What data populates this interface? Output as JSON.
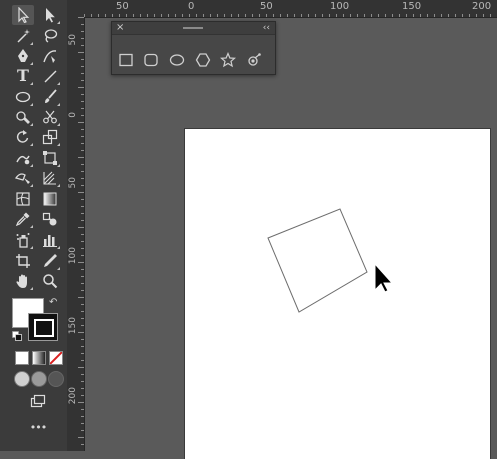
{
  "app": {
    "name": "Adobe Illustrator"
  },
  "toolbar": {
    "tools": [
      {
        "name": "selection-tool",
        "icon": "arrow-icon"
      },
      {
        "name": "direct-selection-tool",
        "icon": "white-arrow-icon"
      },
      {
        "name": "magic-wand-tool",
        "icon": "magic-wand-icon"
      },
      {
        "name": "lasso-tool",
        "icon": "lasso-icon"
      },
      {
        "name": "pen-tool",
        "icon": "pen-icon"
      },
      {
        "name": "curvature-tool",
        "icon": "curvature-pen-icon"
      },
      {
        "name": "type-tool",
        "icon": "type-icon",
        "glyph": "T"
      },
      {
        "name": "line-segment-tool",
        "icon": "line-icon"
      },
      {
        "name": "ellipse-tool",
        "icon": "ellipse-icon"
      },
      {
        "name": "paintbrush-tool",
        "icon": "brush-icon"
      },
      {
        "name": "shaper-tool",
        "icon": "shaper-icon"
      },
      {
        "name": "scissors-tool",
        "icon": "scissors-icon"
      },
      {
        "name": "rotate-tool",
        "icon": "rotate-icon"
      },
      {
        "name": "scale-tool",
        "icon": "scale-icon"
      },
      {
        "name": "warp-tool",
        "icon": "warp-icon"
      },
      {
        "name": "free-transform-tool",
        "icon": "free-transform-icon"
      },
      {
        "name": "shape-builder-tool",
        "icon": "shape-builder-icon"
      },
      {
        "name": "perspective-grid-tool",
        "icon": "perspective-grid-icon"
      },
      {
        "name": "mesh-tool",
        "icon": "mesh-icon"
      },
      {
        "name": "gradient-tool",
        "icon": "gradient-icon"
      },
      {
        "name": "eyedropper-tool",
        "icon": "eyedropper-icon"
      },
      {
        "name": "blend-tool",
        "icon": "blend-icon"
      },
      {
        "name": "symbol-sprayer-tool",
        "icon": "symbol-sprayer-icon"
      },
      {
        "name": "column-graph-tool",
        "icon": "column-graph-icon"
      },
      {
        "name": "artboard-tool",
        "icon": "artboard-icon"
      },
      {
        "name": "slice-tool",
        "icon": "slice-icon"
      },
      {
        "name": "hand-tool",
        "icon": "hand-icon"
      },
      {
        "name": "zoom-tool",
        "icon": "zoom-icon"
      }
    ],
    "fill_color": "#ffffff",
    "stroke_color": "#000000",
    "more_label": "•••"
  },
  "rulers": {
    "horizontal_labels": [
      "50",
      "0",
      "50",
      "100",
      "150",
      "200"
    ],
    "vertical_labels": [
      "50",
      "0",
      "50",
      "100",
      "150",
      "200"
    ]
  },
  "shapes_panel": {
    "close_label": "×",
    "collapse_label": "‹‹",
    "shapes": [
      {
        "name": "rectangle",
        "icon": "rectangle-icon"
      },
      {
        "name": "rounded-rectangle",
        "icon": "rounded-rectangle-icon"
      },
      {
        "name": "ellipse",
        "icon": "ellipse-icon"
      },
      {
        "name": "polygon",
        "icon": "polygon-icon"
      },
      {
        "name": "star",
        "icon": "star-icon"
      },
      {
        "name": "flare",
        "icon": "flare-icon"
      }
    ]
  },
  "canvas": {
    "artboard_color": "#ffffff",
    "pasteboard_color": "#5a5a5a",
    "object": {
      "type": "rectangle",
      "rotation_deg": -20
    }
  }
}
